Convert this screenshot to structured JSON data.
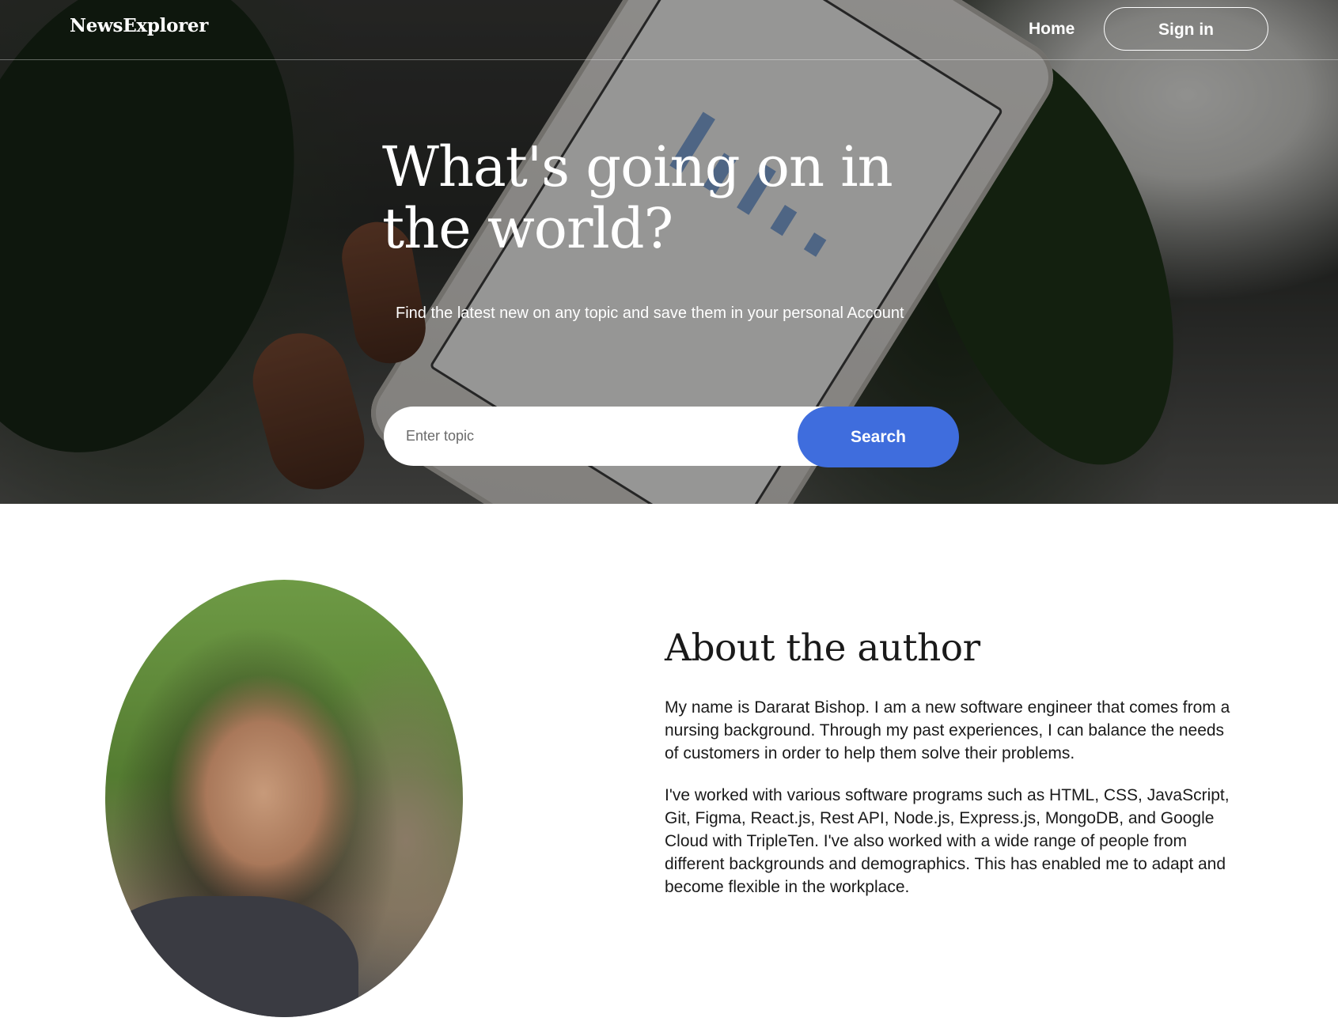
{
  "header": {
    "logo": "NewsExplorer",
    "nav_home": "Home",
    "sign_in": "Sign in"
  },
  "hero": {
    "title": "What's going on in the world?",
    "subtitle": "Find the latest new on any topic and save them in your personal Account",
    "search_placeholder": "Enter topic",
    "search_button": "Search"
  },
  "about": {
    "title": "About the author",
    "paragraph1": "My name is Dararat Bishop. I am a new software engineer that comes from a nursing background. Through my past experiences, I can balance the needs of customers in order to help them solve their problems.",
    "paragraph2": "I've worked with various software programs such as HTML, CSS, JavaScript, Git, Figma, React.js, Rest API, Node.js, Express.js, MongoDB, and Google Cloud with TripleTen. I've also worked with a wide range of people from different backgrounds and demographics. This has enabled me to adapt and become flexible in the workplace."
  },
  "colors": {
    "accent": "#3f6ddd",
    "text": "#1a1a1a",
    "white": "#ffffff"
  }
}
